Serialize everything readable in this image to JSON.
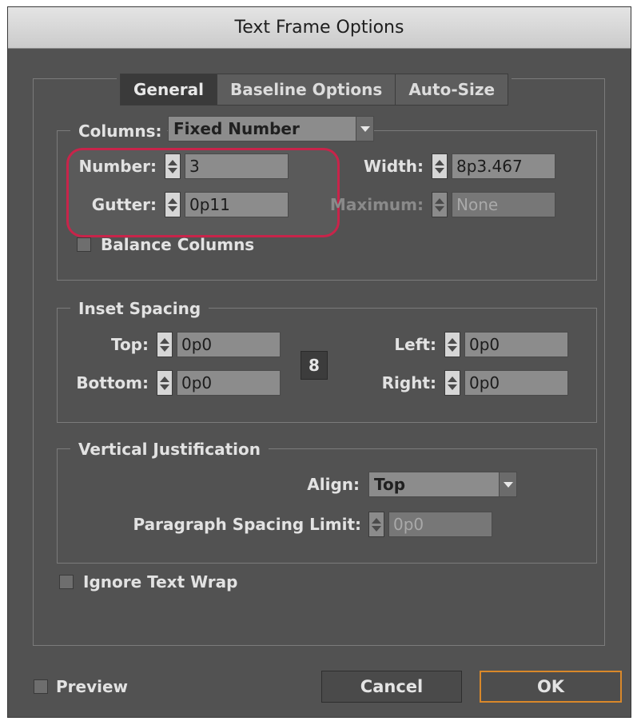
{
  "window": {
    "title": "Text Frame Options"
  },
  "tabs": [
    {
      "label": "General",
      "active": true
    },
    {
      "label": "Baseline Options",
      "active": false
    },
    {
      "label": "Auto-Size",
      "active": false
    }
  ],
  "columns": {
    "legend_label": "Columns:",
    "type_value": "Fixed Number",
    "number_label": "Number:",
    "number_value": "3",
    "gutter_label": "Gutter:",
    "gutter_value": "0p11",
    "width_label": "Width:",
    "width_value": "8p3.467",
    "maximum_label": "Maximum:",
    "maximum_value": "None",
    "balance_label": "Balance Columns"
  },
  "inset": {
    "legend": "Inset Spacing",
    "top_label": "Top:",
    "top_value": "0p0",
    "bottom_label": "Bottom:",
    "bottom_value": "0p0",
    "left_label": "Left:",
    "left_value": "0p0",
    "right_label": "Right:",
    "right_value": "0p0",
    "link_glyph": "8"
  },
  "vertical": {
    "legend": "Vertical Justification",
    "align_label": "Align:",
    "align_value": "Top",
    "spacing_label": "Paragraph Spacing Limit:",
    "spacing_value": "0p0"
  },
  "ignore_wrap_label": "Ignore Text Wrap",
  "footer": {
    "preview_label": "Preview",
    "cancel_label": "Cancel",
    "ok_label": "OK"
  },
  "colors": {
    "dialog_bg": "#525252",
    "highlight": "#c8244a",
    "ok_border": "#d9882a"
  },
  "icons": {
    "spinner": "up-down-stepper-icon",
    "dropdown": "chevron-down-icon",
    "link": "chain-link-icon"
  }
}
